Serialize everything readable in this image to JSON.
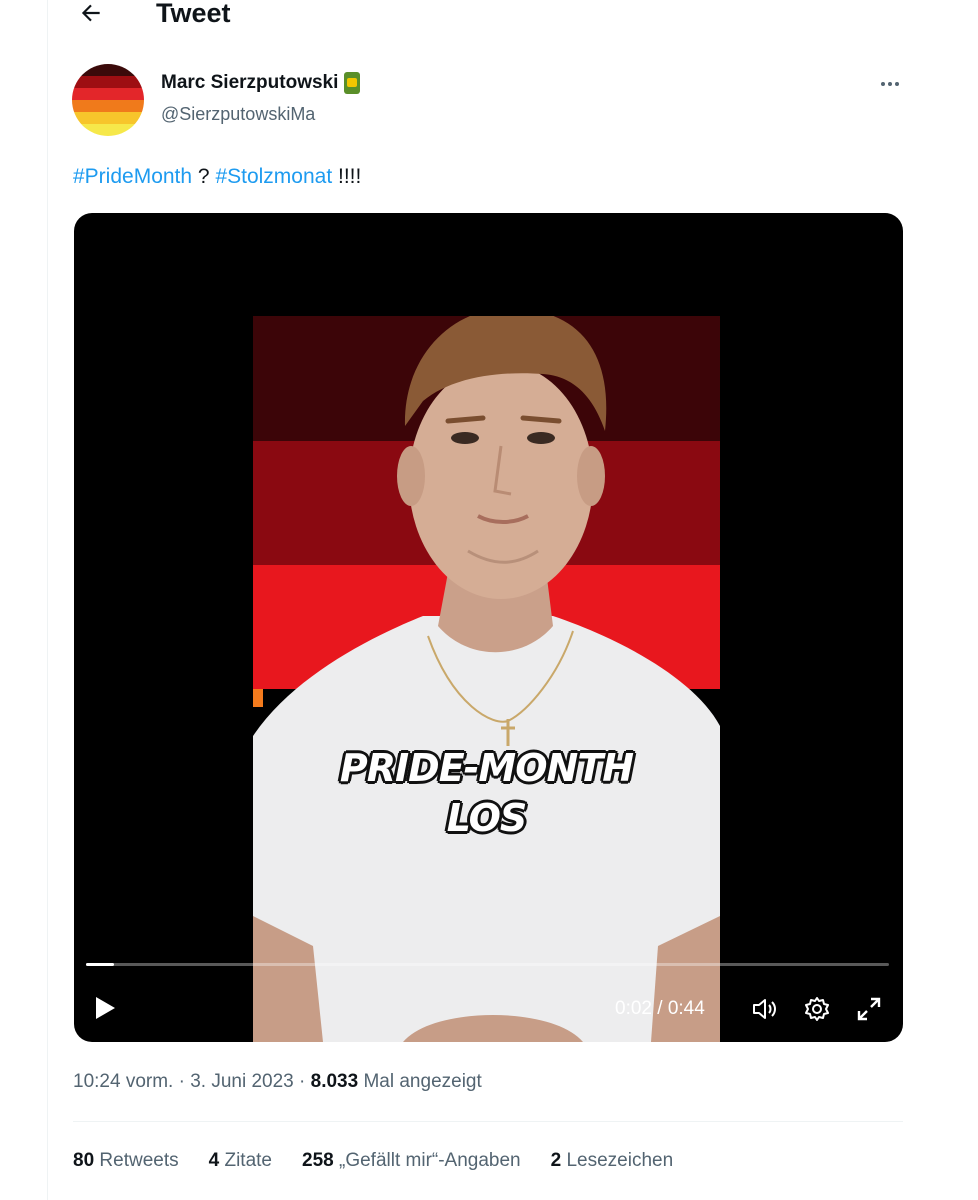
{
  "header": {
    "title": "Tweet",
    "back_icon": "arrow-left-icon"
  },
  "author": {
    "name": "Marc Sierzputowski",
    "handle": "@SierzputowskiMa",
    "badge_icon": "can-emoji-icon",
    "avatar_colors": [
      "#3b0a0a",
      "#9e0e12",
      "#e3262a",
      "#f07a1b",
      "#f7c52b",
      "#f6e84a"
    ]
  },
  "tweet": {
    "hashtag1": "#PrideMonth",
    "separator": " ? ",
    "hashtag2": "#Stolzmonat",
    "suffix": " !!!!"
  },
  "video": {
    "overlay_line1": "PRIDE-MONTH",
    "overlay_line2": "LOS",
    "time": "0:02 / 0:44",
    "progress": 0.035,
    "stripe_colors": [
      "#3c0508",
      "#8a0911",
      "#e8171e",
      "#f47b1d",
      "#f5d51f"
    ]
  },
  "meta": {
    "time": "10:24 vorm.",
    "date": "3. Juni 2023",
    "views_count": "8.033",
    "views_label": "Mal angezeigt"
  },
  "stats": [
    {
      "count": "80",
      "label": "Retweets"
    },
    {
      "count": "4",
      "label": "Zitate"
    },
    {
      "count": "258",
      "label": "„Gefällt mir“-Angaben"
    },
    {
      "count": "2",
      "label": "Lesezeichen"
    }
  ],
  "colors": {
    "accent": "#1d9bf0",
    "secondary_text": "#536471"
  }
}
